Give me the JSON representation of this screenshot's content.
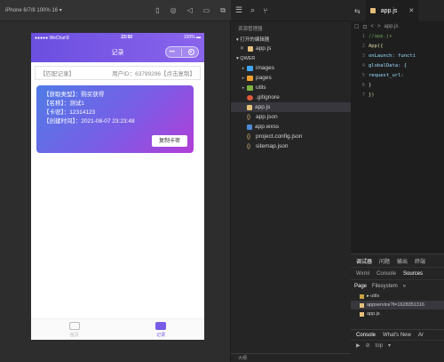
{
  "simulator": {
    "device": "iPhone 6/7/8 100% 16 ▾",
    "tools": [
      "▯",
      "◎",
      "◁",
      "▭",
      "⧉"
    ],
    "status_bar": {
      "carrier": "●●●●● WeChat令",
      "time": "23:50",
      "battery": "100% ▬"
    },
    "nav_title": "记录",
    "capsule_dots": "•••",
    "record": {
      "label": "【匹配记录】",
      "user_id": "用户ID：63799296【点击复制】"
    },
    "card": {
      "line1": "【获取类型】：购买获得",
      "line2": "【名称】：测试1",
      "line3": "【卡密】：12314123",
      "line4": "【创建时间】：2021-08-07 23:23:48",
      "copy_button": "复制卡密"
    },
    "tabbar": [
      {
        "label": "首页"
      },
      {
        "label": "记录"
      }
    ]
  },
  "explorer": {
    "toolbar": [
      "☰",
      "⌕",
      "⑂"
    ],
    "title": "资源管理器",
    "open_editors": "▾ 打开的编辑器",
    "open_file": "app.js",
    "project": "▾ QWER",
    "files": [
      {
        "name": "images",
        "type": "folder-blue"
      },
      {
        "name": "pages",
        "type": "folder-orange"
      },
      {
        "name": "utils",
        "type": "folder-green"
      },
      {
        "name": ".gitignore",
        "type": "git"
      },
      {
        "name": "app.js",
        "type": "js"
      },
      {
        "name": "app.json",
        "type": "json"
      },
      {
        "name": "app.wxss",
        "type": "wxss"
      },
      {
        "name": "project.config.json",
        "type": "json"
      },
      {
        "name": "sitemap.json",
        "type": "json"
      }
    ],
    "bottom_label": "大纲"
  },
  "editor": {
    "tab_name": "app.js",
    "close": "✕",
    "breadcrumb": [
      "☐",
      "⊡",
      "<",
      ">",
      "app.js"
    ],
    "code": [
      {
        "n": "1",
        "text": "//app.js",
        "color": "#6a9955"
      },
      {
        "n": "2",
        "text": "App({",
        "color": "#dcdcaa"
      },
      {
        "n": "3",
        "text": "  onLaunch: functi",
        "color": "#9cdcfe"
      },
      {
        "n": "4",
        "text": "  globalData: {",
        "color": "#9cdcfe"
      },
      {
        "n": "5",
        "text": "    request_url:",
        "color": "#9cdcfe"
      },
      {
        "n": "6",
        "text": "  }",
        "color": "#d4d4d4"
      },
      {
        "n": "7",
        "text": "})",
        "color": "#dcdcaa"
      }
    ]
  },
  "debug": {
    "tabs": [
      "调试器",
      "问题",
      "输出",
      "终端"
    ],
    "sub": [
      "Wxml",
      "Console",
      "Sources"
    ],
    "src_tabs": [
      "Page",
      "Filesystem",
      "»"
    ],
    "rows": [
      "▸ utils",
      "appservice?t=1628351316",
      "app.js"
    ],
    "console_tabs": [
      "Console",
      "What's New",
      "Ar"
    ],
    "console_tools": [
      "▶",
      "⊘",
      "top",
      "▾"
    ]
  }
}
